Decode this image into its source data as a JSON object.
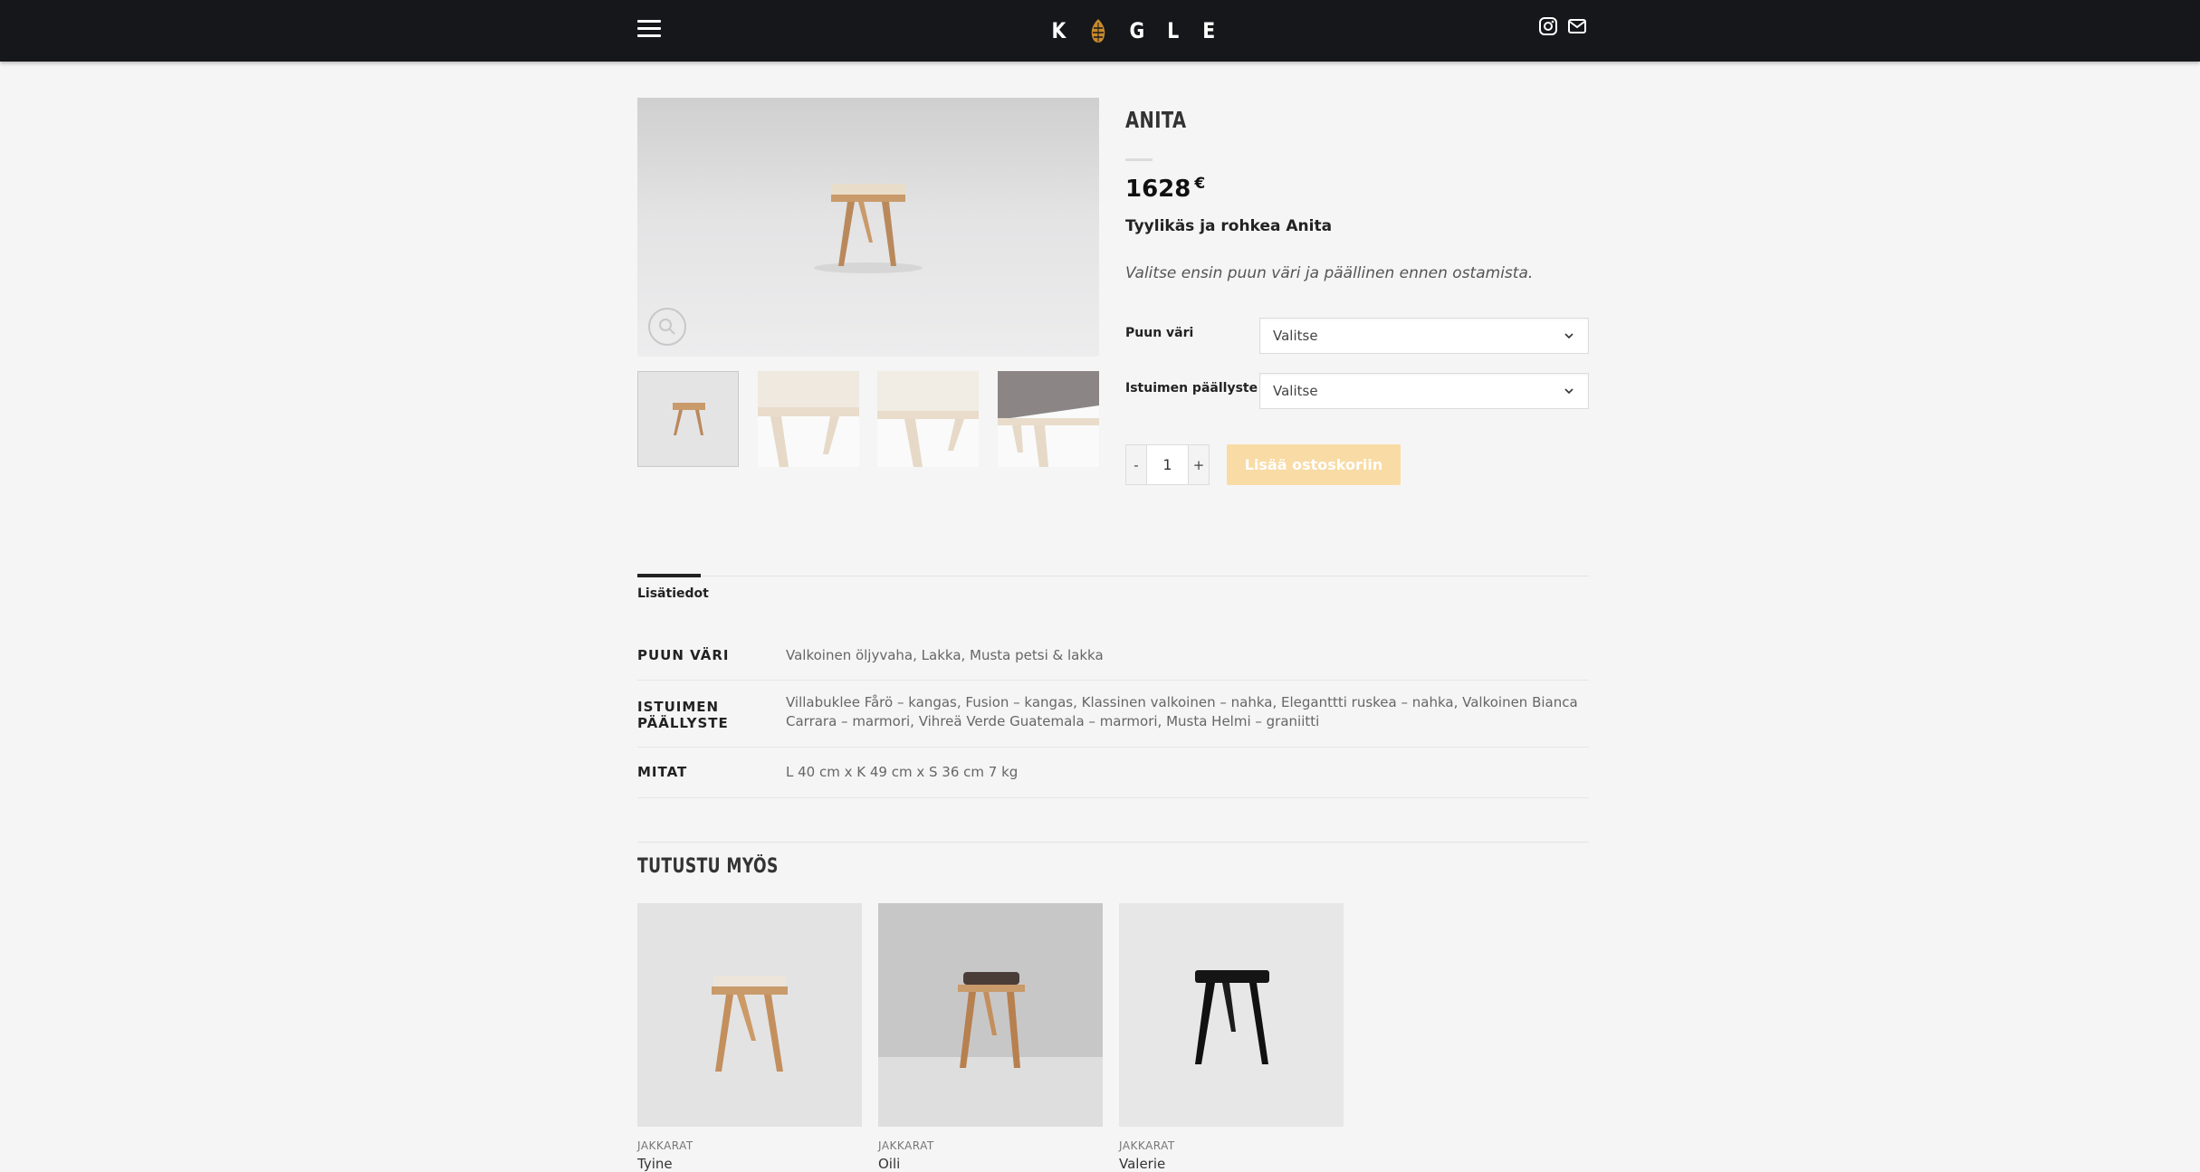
{
  "header": {
    "logo_letters": [
      "K",
      "G",
      "L",
      "E"
    ],
    "icons": [
      "menu-icon",
      "pinecone-logo-icon",
      "instagram-icon",
      "mail-icon"
    ]
  },
  "product": {
    "title": "ANITA",
    "price": "1628",
    "currency": "€",
    "subtitle": "Tyylikäs ja rohkea Anita",
    "note": "Valitse ensin puun väri ja päällinen ennen ostamista.",
    "options": [
      {
        "label": "Puun väri",
        "value": "Valitse"
      },
      {
        "label": "Istuimen päällyste",
        "value": "Valitse"
      }
    ],
    "qty_minus": "-",
    "qty_value": "1",
    "qty_plus": "+",
    "add_to_cart": "Lisää ostoskoriin"
  },
  "tabs": {
    "active": "Lisätiedot"
  },
  "attributes": [
    {
      "key": "PUUN VÄRI",
      "value": "Valkoinen öljyvaha, Lakka, Musta petsi & lakka"
    },
    {
      "key": "ISTUIMEN PÄÄLLYSTE",
      "value": "Villabuklee Fårö – kangas, Fusion – kangas, Klassinen valkoinen – nahka, Eleganttti ruskea – nahka, Valkoinen Bianca Carrara – marmori, Vihreä Verde Guatemala – marmori, Musta Helmi – graniitti"
    },
    {
      "key": "MITAT",
      "value": "L 40 cm x K 49 cm x S 36 cm 7 kg"
    }
  ],
  "related": {
    "title": "TUTUSTU MYÖS",
    "items": [
      {
        "category": "JAKKARAT",
        "name": "Tyine"
      },
      {
        "category": "JAKKARAT",
        "name": "Oili"
      },
      {
        "category": "JAKKARAT",
        "name": "Valerie"
      }
    ]
  },
  "colors": {
    "header_bg": "#16171a",
    "accent_button": "#f9dba5",
    "page_bg": "#f5f5f5",
    "oak": "#c99a6a"
  }
}
